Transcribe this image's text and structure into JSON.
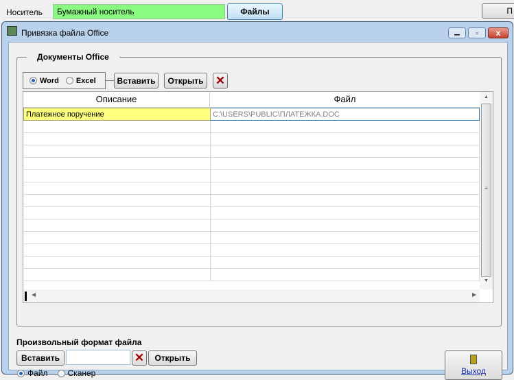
{
  "top": {
    "carrier_label": "Носитель",
    "carrier_value": "Бумажный носитель",
    "files_button": "Файлы",
    "right_button": "П"
  },
  "dialog": {
    "title": "Привязка файла Office"
  },
  "group": {
    "title": "Документы Office",
    "radio_word": "Word",
    "radio_excel": "Excel",
    "selected": "Word",
    "insert_button": "Вставить",
    "open_button": "Открыть",
    "delete_icon": "✕"
  },
  "grid": {
    "columns": [
      "Описание",
      "Файл"
    ],
    "rows": [
      {
        "description": "Платежное поручение",
        "file": "C:\\USERS\\PUBLIC\\ПЛАТЕЖКА.DOC"
      }
    ]
  },
  "custom": {
    "title": "Произвольный формат файла",
    "insert_button": "Вставить",
    "input_value": "",
    "open_button": "Открыть",
    "radio_file": "Файл",
    "radio_scanner": "Сканер",
    "selected": "Файл"
  },
  "exit_button": "Выход"
}
